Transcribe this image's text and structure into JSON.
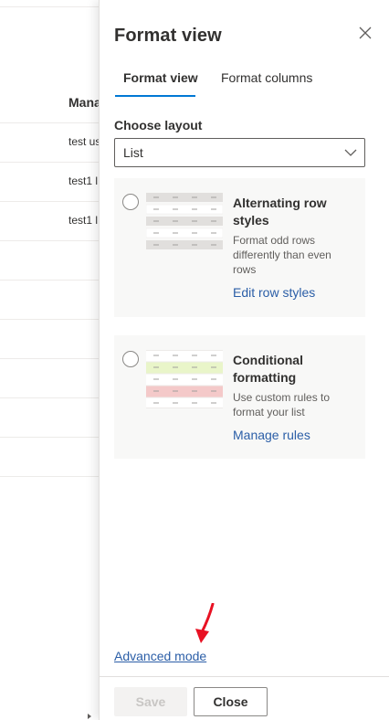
{
  "background_list": {
    "column_header": "Mana",
    "cells": [
      "test us",
      "test1 l",
      "test1 l"
    ]
  },
  "panel": {
    "title": "Format view",
    "close_icon": "close-icon",
    "tabs": [
      {
        "label": "Format view",
        "active": true
      },
      {
        "label": "Format columns",
        "active": false
      }
    ],
    "choose_layout_label": "Choose layout",
    "layout_select": {
      "value": "List",
      "icon": "chevron-down-icon"
    },
    "cards": [
      {
        "title": "Alternating row styles",
        "description": "Format odd rows differently than even rows",
        "link": "Edit row styles",
        "selected": false
      },
      {
        "title": "Conditional formatting",
        "description": "Use custom rules to format your list",
        "link": "Manage rules",
        "selected": false
      }
    ],
    "advanced_link": "Advanced mode",
    "footer": {
      "save_label": "Save",
      "close_label": "Close"
    }
  },
  "colors": {
    "accent": "#0078d4",
    "link": "#2b5ea7",
    "annotation_arrow": "#e81123",
    "conditional_green": "#e9f5c9",
    "conditional_red": "#f4c9c9",
    "alt_row_gray": "#e1dfdd"
  }
}
